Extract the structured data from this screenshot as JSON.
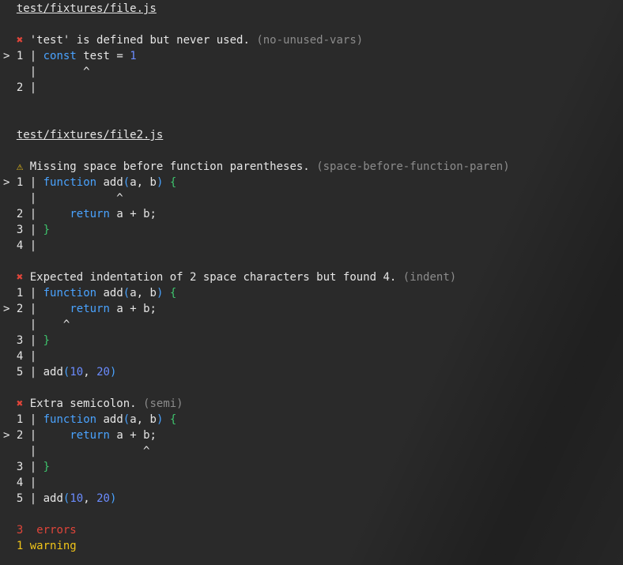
{
  "colors": {
    "background": "#2a2a2a",
    "text": "#e6e6e6",
    "error": "#e0453a",
    "warning": "#f0c419",
    "rule": "#8c8c8c",
    "keyword": "#4aa3ff",
    "number": "#6b8cff",
    "brace": "#3ec46d"
  },
  "files": [
    {
      "path": "test/fixtures/file.js",
      "messages": [
        {
          "severity": "error",
          "icon": "✖",
          "text": "'test' is defined but never used.",
          "rule": "(no-unused-vars)",
          "code_lines": [
            {
              "marker": ">",
              "num": "1",
              "code": "const test = 1"
            },
            {
              "caret": "       ^"
            },
            {
              "marker": " ",
              "num": "2",
              "code": ""
            }
          ]
        }
      ]
    },
    {
      "path": "test/fixtures/file2.js",
      "messages": [
        {
          "severity": "warning",
          "icon": "⚠",
          "text": "Missing space before function parentheses.",
          "rule": "(space-before-function-paren)",
          "code_lines": [
            {
              "marker": ">",
              "num": "1",
              "code": "function add(a, b) {"
            },
            {
              "caret": "            ^"
            },
            {
              "marker": " ",
              "num": "2",
              "code": "    return a + b;"
            },
            {
              "marker": " ",
              "num": "3",
              "code": "}"
            },
            {
              "marker": " ",
              "num": "4",
              "code": ""
            }
          ]
        },
        {
          "severity": "error",
          "icon": "✖",
          "text": "Expected indentation of 2 space characters but found 4.",
          "rule": "(indent)",
          "code_lines": [
            {
              "marker": " ",
              "num": "1",
              "code": "function add(a, b) {"
            },
            {
              "marker": ">",
              "num": "2",
              "code": "    return a + b;"
            },
            {
              "caret": "    ^"
            },
            {
              "marker": " ",
              "num": "3",
              "code": "}"
            },
            {
              "marker": " ",
              "num": "4",
              "code": ""
            },
            {
              "marker": " ",
              "num": "5",
              "code": "add(10, 20)"
            }
          ]
        },
        {
          "severity": "error",
          "icon": "✖",
          "text": "Extra semicolon.",
          "rule": "(semi)",
          "code_lines": [
            {
              "marker": " ",
              "num": "1",
              "code": "function add(a, b) {"
            },
            {
              "marker": ">",
              "num": "2",
              "code": "    return a + b;"
            },
            {
              "caret": "                ^"
            },
            {
              "marker": " ",
              "num": "3",
              "code": "}"
            },
            {
              "marker": " ",
              "num": "4",
              "code": ""
            },
            {
              "marker": " ",
              "num": "5",
              "code": "add(10, 20)"
            }
          ]
        }
      ]
    }
  ],
  "summary": {
    "errors_count": "3",
    "errors_label": "errors",
    "warnings_count": "1",
    "warnings_label": "warning"
  }
}
